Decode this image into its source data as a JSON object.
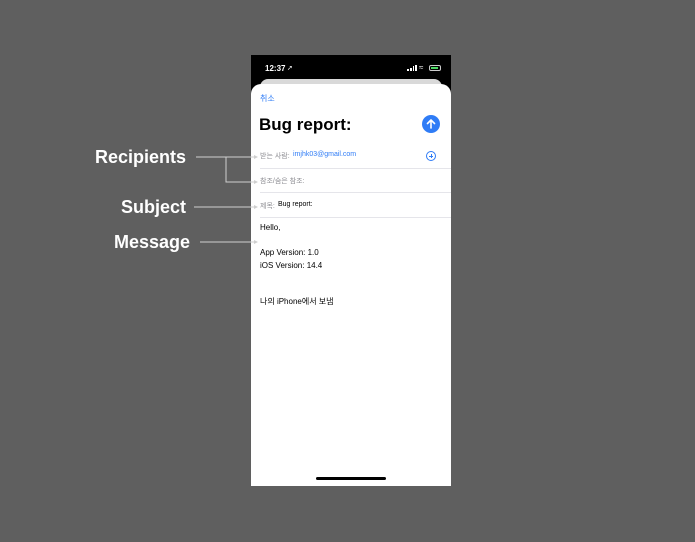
{
  "status_bar": {
    "time": "12:37",
    "location_glyph": "➚",
    "wifi_glyph": "≈"
  },
  "compose": {
    "cancel_label": "취소",
    "title": "Bug report:",
    "to_label": "받는 사람:",
    "to_value": "imjhk03@gmail.com",
    "cc_label": "참조/숨은 참조:",
    "subject_label": "제목:",
    "subject_value": "Bug report:",
    "body": {
      "greeting": "Hello,",
      "app_version": "App Version: 1.0",
      "ios_version": "iOS Version: 14.4",
      "signature": "나의 iPhone에서 보냄"
    }
  },
  "annotations": {
    "recipients": "Recipients",
    "subject": "Subject",
    "message": "Message"
  },
  "colors": {
    "accent": "#2f7cf6",
    "background": "#5f5f5f"
  },
  "icons": [
    "location-arrow-icon",
    "signal-icon",
    "wifi-icon",
    "battery-icon",
    "send-arrow-icon",
    "add-contact-icon"
  ]
}
